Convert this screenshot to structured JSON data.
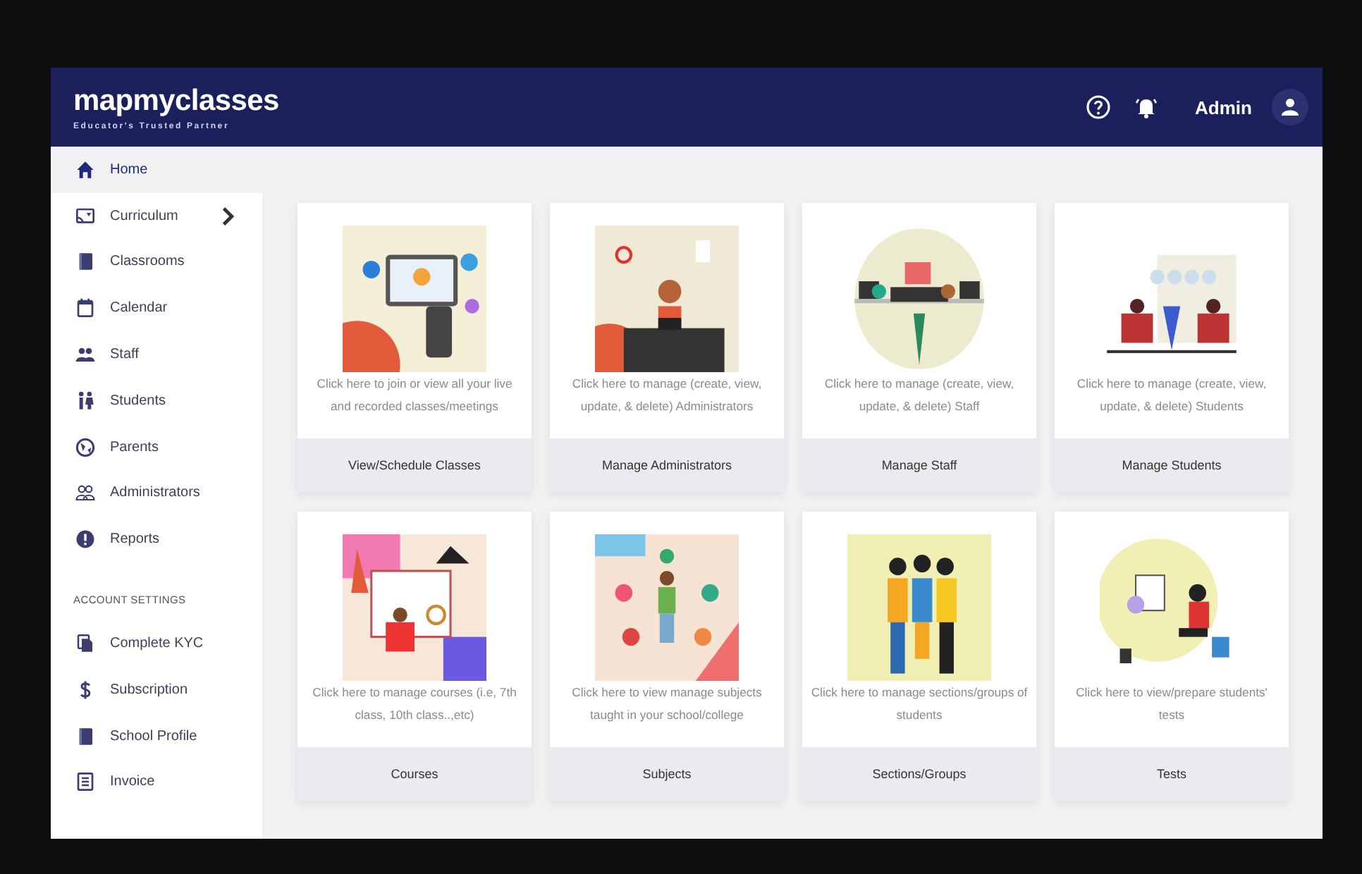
{
  "header": {
    "logo": "mapmyclasses",
    "tagline": "Educator's Trusted Partner",
    "user": "Admin"
  },
  "sidebar": {
    "items": [
      {
        "label": "Home",
        "selected": true,
        "has_submenu": false
      },
      {
        "label": "Curriculum",
        "selected": false,
        "has_submenu": true
      },
      {
        "label": "Classrooms",
        "selected": false,
        "has_submenu": false
      },
      {
        "label": "Calendar",
        "selected": false,
        "has_submenu": false
      },
      {
        "label": "Staff",
        "selected": false,
        "has_submenu": false
      },
      {
        "label": "Students",
        "selected": false,
        "has_submenu": false
      },
      {
        "label": "Parents",
        "selected": false,
        "has_submenu": false
      },
      {
        "label": "Administrators",
        "selected": false,
        "has_submenu": false
      },
      {
        "label": "Reports",
        "selected": false,
        "has_submenu": false
      }
    ],
    "section_title": "ACCOUNT SETTINGS",
    "account_items": [
      {
        "label": "Complete KYC",
        "selected": false
      },
      {
        "label": "Subscription",
        "selected": false
      },
      {
        "label": "School Profile",
        "selected": false
      },
      {
        "label": "Invoice",
        "selected": false
      }
    ]
  },
  "cards": [
    {
      "description": "Click here to join or view all your live and recorded classes/meetings",
      "action": "View/Schedule Classes"
    },
    {
      "description": "Click here to manage (create, view, update, & delete) Administrators",
      "action": "Manage Administrators"
    },
    {
      "description": "Click here to manage (create, view, update, & delete) Staff",
      "action": "Manage Staff"
    },
    {
      "description": "Click here to manage (create, view, update, & delete) Students",
      "action": "Manage Students"
    },
    {
      "description": "Click here to manage courses (i.e, 7th class, 10th class..,etc)",
      "action": "Courses"
    },
    {
      "description": "Click here to view manage subjects taught in your school/college",
      "action": "Subjects"
    },
    {
      "description": "Click here to manage sections/groups of students",
      "action": "Sections/Groups"
    },
    {
      "description": "Click here to view/prepare students' tests",
      "action": "Tests"
    }
  ]
}
